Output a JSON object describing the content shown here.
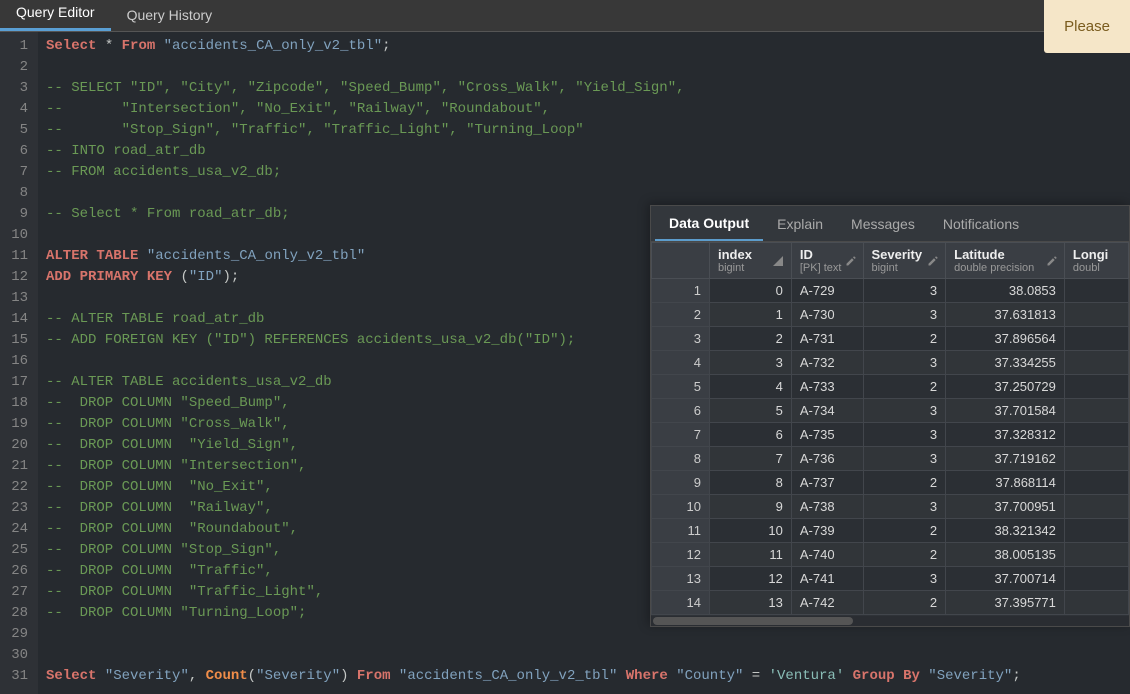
{
  "notice": {
    "text": "Please"
  },
  "tabs": [
    {
      "label": "Query Editor",
      "active": true
    },
    {
      "label": "Query History",
      "active": false
    }
  ],
  "editor": {
    "lines": [
      {
        "n": 1,
        "tokens": [
          [
            "Select",
            "keyword"
          ],
          [
            " ",
            "punc"
          ],
          [
            "*",
            "punc"
          ],
          [
            " ",
            "punc"
          ],
          [
            "From",
            "keyword"
          ],
          [
            " ",
            "punc"
          ],
          [
            "\"accidents_CA_only_v2_tbl\"",
            "string2"
          ],
          [
            ";",
            "punc"
          ]
        ]
      },
      {
        "n": 2,
        "tokens": [
          [
            "",
            "punc"
          ]
        ]
      },
      {
        "n": 3,
        "tokens": [
          [
            "-- SELECT \"ID\", \"City\", \"Zipcode\", \"Speed_Bump\", \"Cross_Walk\", \"Yield_Sign\",",
            "comment"
          ]
        ]
      },
      {
        "n": 4,
        "tokens": [
          [
            "--       \"Intersection\", \"No_Exit\", \"Railway\", \"Roundabout\",",
            "comment"
          ]
        ]
      },
      {
        "n": 5,
        "tokens": [
          [
            "--       \"Stop_Sign\", \"Traffic\", \"Traffic_Light\", \"Turning_Loop\"",
            "comment"
          ]
        ]
      },
      {
        "n": 6,
        "tokens": [
          [
            "-- INTO road_atr_db",
            "comment"
          ]
        ]
      },
      {
        "n": 7,
        "tokens": [
          [
            "-- FROM accidents_usa_v2_db;",
            "comment"
          ]
        ]
      },
      {
        "n": 8,
        "tokens": [
          [
            "",
            "punc"
          ]
        ]
      },
      {
        "n": 9,
        "tokens": [
          [
            "-- Select * From road_atr_db;",
            "comment"
          ]
        ]
      },
      {
        "n": 10,
        "tokens": [
          [
            "",
            "punc"
          ]
        ]
      },
      {
        "n": 11,
        "tokens": [
          [
            "ALTER",
            "keyword"
          ],
          [
            " ",
            "punc"
          ],
          [
            "TABLE",
            "keyword"
          ],
          [
            " ",
            "punc"
          ],
          [
            "\"accidents_CA_only_v2_tbl\"",
            "string2"
          ]
        ]
      },
      {
        "n": 12,
        "tokens": [
          [
            "ADD",
            "keyword"
          ],
          [
            " ",
            "punc"
          ],
          [
            "PRIMARY",
            "keyword"
          ],
          [
            " ",
            "punc"
          ],
          [
            "KEY",
            "keyword"
          ],
          [
            " (",
            "punc"
          ],
          [
            "\"ID\"",
            "string2"
          ],
          [
            ");",
            "punc"
          ]
        ]
      },
      {
        "n": 13,
        "tokens": [
          [
            "",
            "punc"
          ]
        ]
      },
      {
        "n": 14,
        "tokens": [
          [
            "-- ALTER TABLE road_atr_db",
            "comment"
          ]
        ]
      },
      {
        "n": 15,
        "tokens": [
          [
            "-- ADD FOREIGN KEY (\"ID\") REFERENCES accidents_usa_v2_db(\"ID\");",
            "comment"
          ]
        ]
      },
      {
        "n": 16,
        "tokens": [
          [
            "",
            "punc"
          ]
        ]
      },
      {
        "n": 17,
        "tokens": [
          [
            "-- ALTER TABLE accidents_usa_v2_db",
            "comment"
          ]
        ]
      },
      {
        "n": 18,
        "tokens": [
          [
            "--  DROP COLUMN \"Speed_Bump\",",
            "comment"
          ]
        ]
      },
      {
        "n": 19,
        "tokens": [
          [
            "--  DROP COLUMN \"Cross_Walk\",",
            "comment"
          ]
        ]
      },
      {
        "n": 20,
        "tokens": [
          [
            "--  DROP COLUMN  \"Yield_Sign\",",
            "comment"
          ]
        ]
      },
      {
        "n": 21,
        "tokens": [
          [
            "--  DROP COLUMN \"Intersection\",",
            "comment"
          ]
        ]
      },
      {
        "n": 22,
        "tokens": [
          [
            "--  DROP COLUMN  \"No_Exit\",",
            "comment"
          ]
        ]
      },
      {
        "n": 23,
        "tokens": [
          [
            "--  DROP COLUMN  \"Railway\",",
            "comment"
          ]
        ]
      },
      {
        "n": 24,
        "tokens": [
          [
            "--  DROP COLUMN  \"Roundabout\",",
            "comment"
          ]
        ]
      },
      {
        "n": 25,
        "tokens": [
          [
            "--  DROP COLUMN \"Stop_Sign\",",
            "comment"
          ]
        ]
      },
      {
        "n": 26,
        "tokens": [
          [
            "--  DROP COLUMN  \"Traffic\",",
            "comment"
          ]
        ]
      },
      {
        "n": 27,
        "tokens": [
          [
            "--  DROP COLUMN  \"Traffic_Light\",",
            "comment"
          ]
        ]
      },
      {
        "n": 28,
        "tokens": [
          [
            "--  DROP COLUMN \"Turning_Loop\";",
            "comment"
          ]
        ]
      },
      {
        "n": 29,
        "tokens": [
          [
            "",
            "punc"
          ]
        ]
      },
      {
        "n": 30,
        "tokens": [
          [
            "",
            "punc"
          ]
        ]
      },
      {
        "n": 31,
        "tokens": [
          [
            "Select",
            "keyword"
          ],
          [
            " ",
            "punc"
          ],
          [
            "\"Severity\"",
            "string2"
          ],
          [
            ", ",
            "punc"
          ],
          [
            "Count",
            "keyword3"
          ],
          [
            "(",
            "punc"
          ],
          [
            "\"Severity\"",
            "string2"
          ],
          [
            ") ",
            "punc"
          ],
          [
            "From",
            "keyword"
          ],
          [
            " ",
            "punc"
          ],
          [
            "\"accidents_CA_only_v2_tbl\"",
            "string2"
          ],
          [
            " ",
            "punc"
          ],
          [
            "Where",
            "keyword"
          ],
          [
            " ",
            "punc"
          ],
          [
            "\"County\"",
            "string2"
          ],
          [
            " = ",
            "punc"
          ],
          [
            "'Ventura'",
            "string"
          ],
          [
            " ",
            "punc"
          ],
          [
            "Group",
            "keyword"
          ],
          [
            " ",
            "punc"
          ],
          [
            "By",
            "keyword"
          ],
          [
            " ",
            "punc"
          ],
          [
            "\"Severity\"",
            "string2"
          ],
          [
            ";",
            "punc"
          ]
        ]
      }
    ]
  },
  "data_panel": {
    "tabs": [
      {
        "label": "Data Output",
        "active": true
      },
      {
        "label": "Explain",
        "active": false
      },
      {
        "label": "Messages",
        "active": false
      },
      {
        "label": "Notifications",
        "active": false
      }
    ],
    "columns": [
      {
        "name": "index",
        "type": "bigint",
        "align": "num"
      },
      {
        "name": "ID",
        "type": "[PK] text",
        "align": "text"
      },
      {
        "name": "Severity",
        "type": "bigint",
        "align": "num"
      },
      {
        "name": "Latitude",
        "type": "double precision",
        "align": "num"
      },
      {
        "name": "Longi",
        "type": "doubl",
        "align": "num",
        "truncated": true
      }
    ],
    "rows": [
      {
        "n": 1,
        "cells": [
          "0",
          "A-729",
          "3",
          "38.0853",
          ""
        ]
      },
      {
        "n": 2,
        "cells": [
          "1",
          "A-730",
          "3",
          "37.631813",
          ""
        ]
      },
      {
        "n": 3,
        "cells": [
          "2",
          "A-731",
          "2",
          "37.896564",
          ""
        ]
      },
      {
        "n": 4,
        "cells": [
          "3",
          "A-732",
          "3",
          "37.334255",
          ""
        ]
      },
      {
        "n": 5,
        "cells": [
          "4",
          "A-733",
          "2",
          "37.250729",
          ""
        ]
      },
      {
        "n": 6,
        "cells": [
          "5",
          "A-734",
          "3",
          "37.701584",
          ""
        ]
      },
      {
        "n": 7,
        "cells": [
          "6",
          "A-735",
          "3",
          "37.328312",
          ""
        ]
      },
      {
        "n": 8,
        "cells": [
          "7",
          "A-736",
          "3",
          "37.719162",
          ""
        ]
      },
      {
        "n": 9,
        "cells": [
          "8",
          "A-737",
          "2",
          "37.868114",
          ""
        ]
      },
      {
        "n": 10,
        "cells": [
          "9",
          "A-738",
          "3",
          "37.700951",
          ""
        ]
      },
      {
        "n": 11,
        "cells": [
          "10",
          "A-739",
          "2",
          "38.321342",
          ""
        ]
      },
      {
        "n": 12,
        "cells": [
          "11",
          "A-740",
          "2",
          "38.005135",
          ""
        ]
      },
      {
        "n": 13,
        "cells": [
          "12",
          "A-741",
          "3",
          "37.700714",
          ""
        ]
      },
      {
        "n": 14,
        "cells": [
          "13",
          "A-742",
          "2",
          "37.395771",
          ""
        ]
      }
    ]
  }
}
